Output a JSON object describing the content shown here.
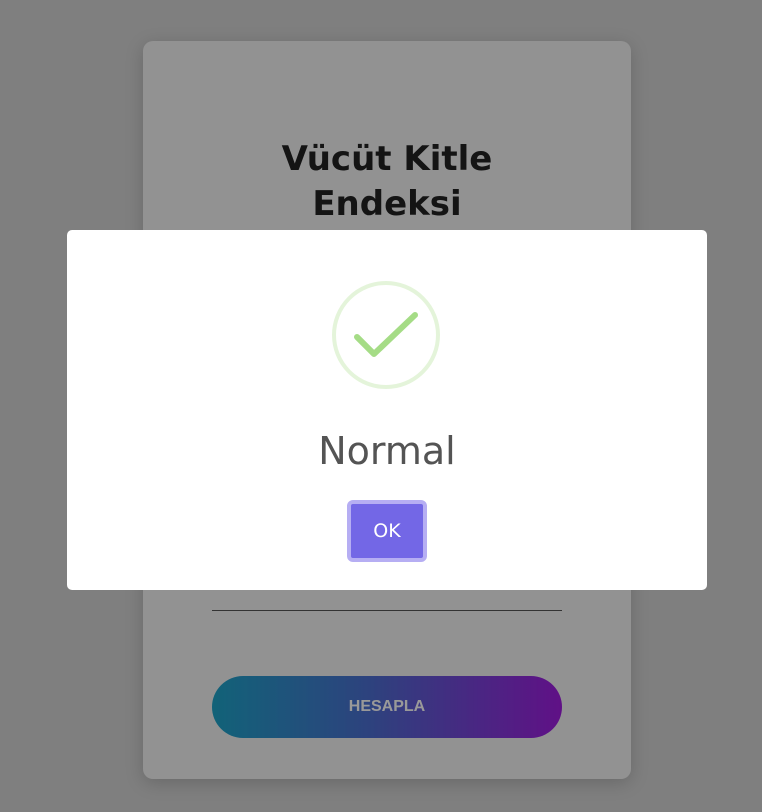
{
  "card": {
    "title_line1": "Vücüt Kitle",
    "title_line2": "Endeksi",
    "calculate_label": "HESAPLA"
  },
  "alert": {
    "icon": "check-icon",
    "title": "Normal",
    "ok_label": "OK"
  },
  "colors": {
    "accent": "#7367e6",
    "success": "#a5dc86",
    "gradient_start": "#1ea4c9",
    "gradient_end": "#a01ce0"
  }
}
